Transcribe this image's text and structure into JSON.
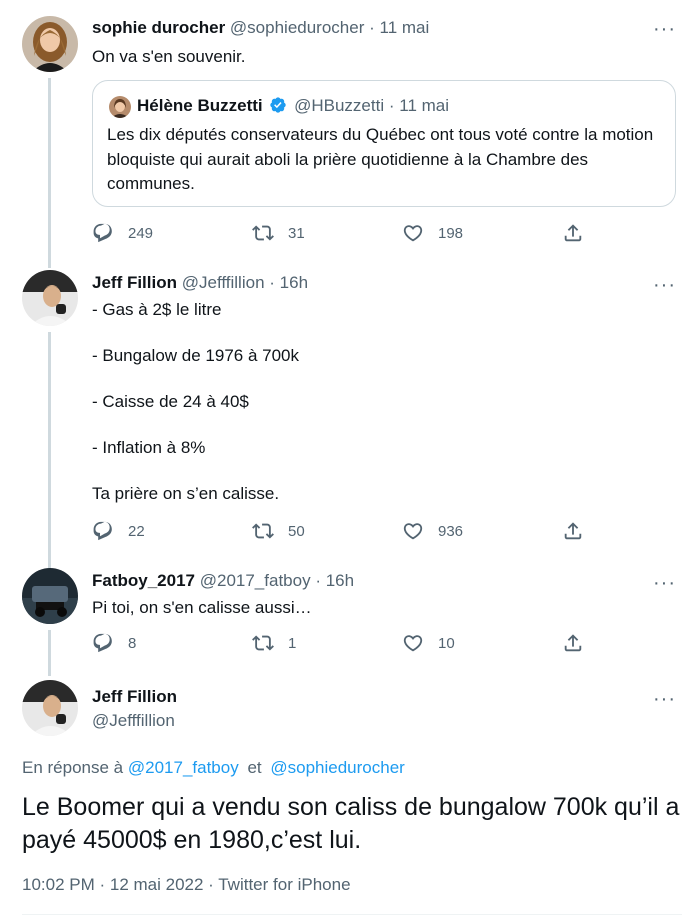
{
  "colors": {
    "text": "#0f1419",
    "secondary": "#536471",
    "link": "#1d9bf0",
    "border": "#cfd9de",
    "verified": "#1d9bf0"
  },
  "icons": {
    "reply": "reply-icon",
    "retweet": "retweet-icon",
    "like": "heart-icon",
    "share": "share-icon",
    "more": "more-options-icon",
    "verified": "verified-badge-icon"
  },
  "tweets": [
    {
      "name": "sophie durocher",
      "handle": "@sophiedurocher",
      "sep": "·",
      "time": "11 mai",
      "text": "On va s'en souvenir.",
      "quote": {
        "name": "Hélène Buzzetti",
        "handle": "@HBuzzetti",
        "sep": "·",
        "time": "11 mai",
        "text": "Les dix députés conservateurs du Québec ont tous voté contre la motion bloquiste qui aurait aboli la prière quotidienne à la Chambre des communes."
      },
      "replies": "249",
      "retweets": "31",
      "likes": "198"
    },
    {
      "name": "Jeff Fillion",
      "handle": "@Jefffillion",
      "sep": "·",
      "time": "16h",
      "text": "- Gas à 2$ le litre\n\n- Bungalow de 1976 à 700k\n\n- Caisse de 24 à 40$\n\n- Inflation à 8%\n\nTa prière on s’en calisse.",
      "replies": "22",
      "retweets": "50",
      "likes": "936"
    },
    {
      "name": "Fatboy_2017",
      "handle": "@2017_fatboy",
      "sep": "·",
      "time": "16h",
      "text": "Pi toi, on s'en calisse aussi…",
      "replies": "8",
      "retweets": "1",
      "likes": "10"
    }
  ],
  "main": {
    "name": "Jeff Fillion",
    "handle": "@Jefffillion",
    "replying_prefix": "En réponse à",
    "replying_to_1": "@2017_fatboy",
    "replying_and": "et",
    "replying_to_2": "@sophiedurocher",
    "text": "Le Boomer qui a vendu son caliss de bungalow 700k qu’il a payé 45000$ en 1980,c’est lui.",
    "meta": "10:02 PM · 12 mai 2022 · Twitter for iPhone"
  }
}
